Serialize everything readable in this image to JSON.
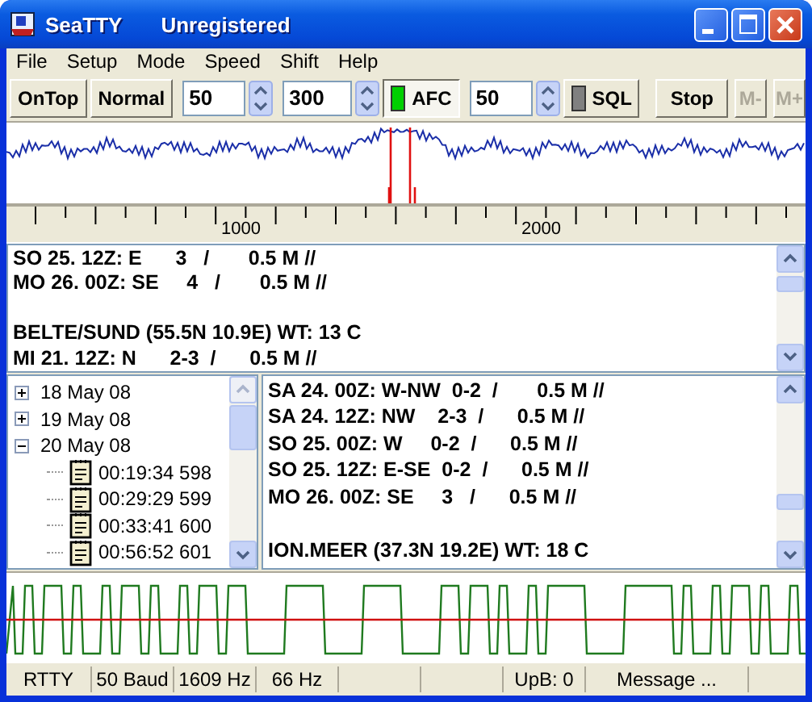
{
  "window": {
    "title": "SeaTTY",
    "subtitle": "Unregistered"
  },
  "menu": [
    {
      "label": "File"
    },
    {
      "label": "Setup"
    },
    {
      "label": "Mode"
    },
    {
      "label": "Speed"
    },
    {
      "label": "Shift"
    },
    {
      "label": "Help"
    }
  ],
  "toolbar": [
    {
      "kind": "button",
      "label": "OnTop",
      "disabled": false
    },
    {
      "kind": "button",
      "label": "Normal",
      "disabled": false
    },
    {
      "kind": "spin",
      "value": "50"
    },
    {
      "kind": "spin",
      "value": "300"
    },
    {
      "kind": "toggle",
      "label": "AFC",
      "on": true
    },
    {
      "kind": "spin",
      "value": "50"
    },
    {
      "kind": "toggle",
      "label": "SQL",
      "on": false
    },
    {
      "kind": "button",
      "label": "Stop",
      "disabled": false
    },
    {
      "kind": "button",
      "label": "M-",
      "disabled": true
    },
    {
      "kind": "button",
      "label": "M+",
      "disabled": true
    }
  ],
  "ruler": {
    "labels": [
      "1000",
      "2000"
    ]
  },
  "upper_text": [
    [
      "SO 25. 12Z: E      3   /       0.5 M //",
      "MO 26. 00Z: SE     4   /       0.5 M //"
    ],
    [
      "BELTE/SUND (55.5N 10.9E) WT: 13 C",
      "MI 21. 12Z: N      2-3  /      0.5 M //"
    ]
  ],
  "tree": [
    {
      "label": "18 May 08",
      "expanded": false
    },
    {
      "label": "19 May 08",
      "expanded": false
    },
    {
      "label": "20 May 08",
      "expanded": true,
      "children": [
        {
          "label": "00:19:34 598"
        },
        {
          "label": "00:29:29 599"
        },
        {
          "label": "00:33:41 600"
        },
        {
          "label": "00:56:52 601"
        }
      ]
    }
  ],
  "lower_text": [
    [
      "SA 24. 00Z: W-NW  0-2  /       0.5 M //",
      "SA 24. 12Z: NW    2-3  /      0.5 M //",
      "SO 25. 00Z: W     0-2  /      0.5 M //",
      "SO 25. 12Z: E-SE  0-2  /      0.5 M //",
      "MO 26. 00Z: SE     3   /      0.5 M //"
    ],
    [
      "ION.MEER (37.3N 19.2E) WT: 18 C"
    ]
  ],
  "status_bar": [
    "RTTY",
    "50 Baud",
    "1609 Hz",
    "66 Hz",
    "UpB: 0",
    "Message ..."
  ]
}
